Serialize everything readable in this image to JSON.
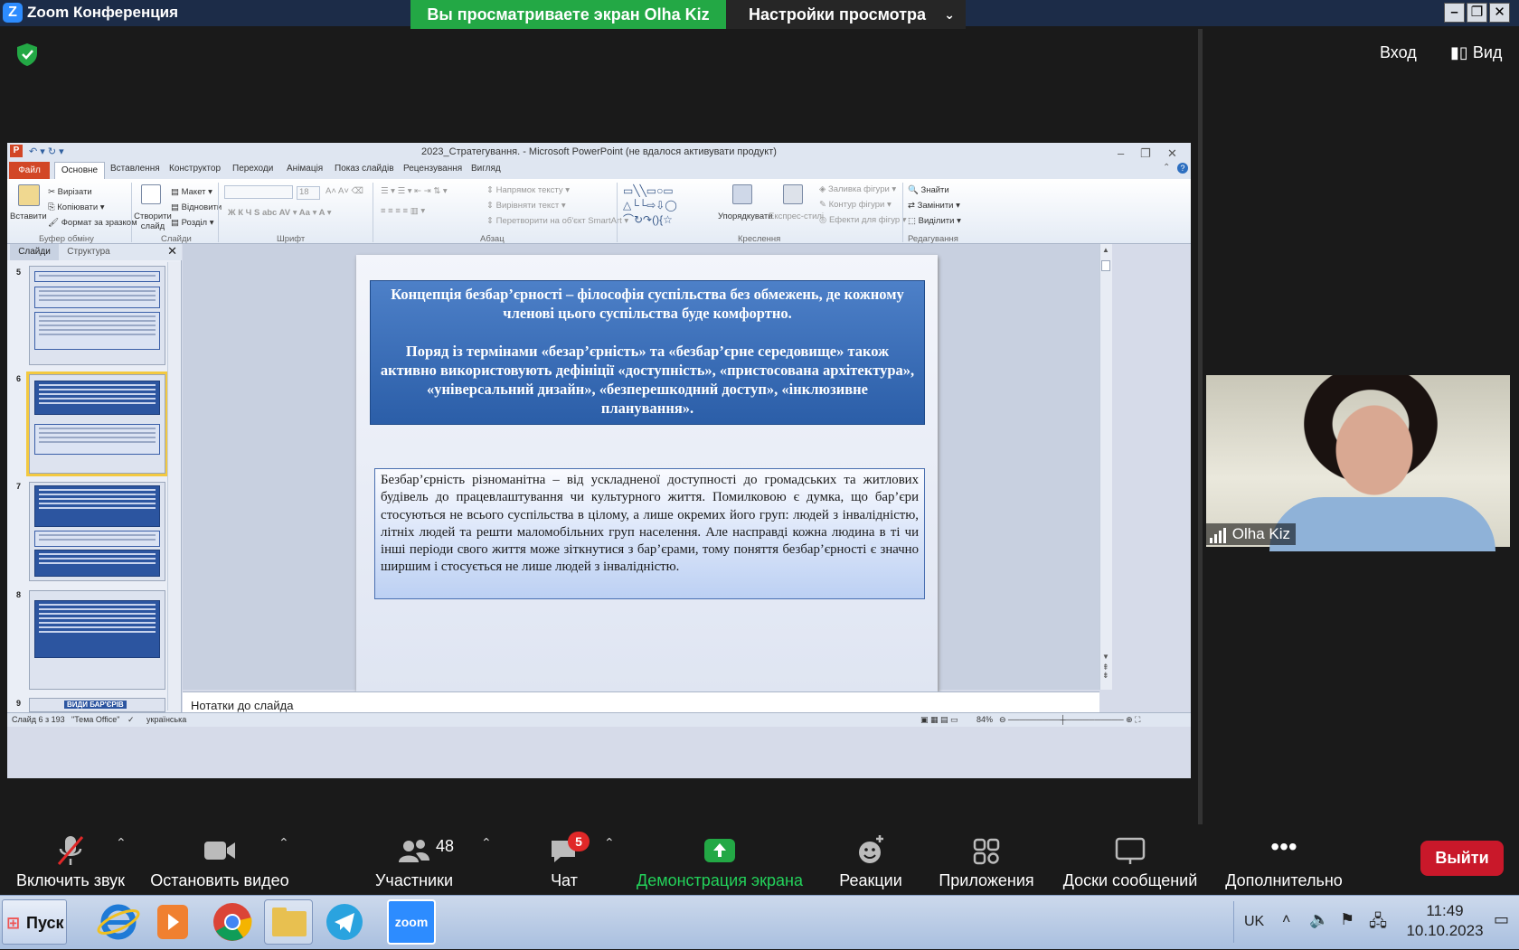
{
  "zoom": {
    "window_title": "Zoom Конференция",
    "viewing_banner": "Вы просматриваете экран Olha Kiz",
    "view_settings": "Настройки просмотра",
    "enter_label": "Вход",
    "view_label": "Вид",
    "participant_name": "Olha Kiz",
    "toolbar": {
      "mute": "Включить звук",
      "video": "Остановить видео",
      "participants": "Участники",
      "participants_count": "48",
      "chat": "Чат",
      "chat_badge": "5",
      "share": "Демонстрация экрана",
      "reactions": "Реакции",
      "apps": "Приложения",
      "whiteboards": "Доски сообщений",
      "more": "Дополнительно",
      "leave": "Выйти"
    }
  },
  "ppt": {
    "title": "2023_Стратегування. - Microsoft PowerPoint (не вдалося активувати продукт)",
    "tabs": [
      "Файл",
      "Основне",
      "Вставлення",
      "Конструктор",
      "Переходи",
      "Анімація",
      "Показ слайдів",
      "Рецензування",
      "Вигляд"
    ],
    "ribbon": {
      "paste": "Вставити",
      "cut": "Вирізати",
      "copy": "Копіювати",
      "format_painter": "Формат за зразком",
      "clipboard": "Буфер обміну",
      "new_slide": "Створити слайд",
      "layout": "Макет",
      "reset": "Відновити",
      "section": "Розділ",
      "slides": "Слайди",
      "font_size": "18",
      "font": "Шрифт",
      "text_direction": "Напрямок тексту",
      "align_text": "Вирівняти текст",
      "smartart": "Перетворити на об'єкт SmartArt",
      "paragraph": "Абзац",
      "arrange": "Упорядкувати",
      "quick_styles": "Експрес-стилі",
      "shape_fill": "Заливка фігури",
      "shape_outline": "Контур фігури",
      "shape_effects": "Ефекти для фігур",
      "drawing": "Креслення",
      "find": "Знайти",
      "replace": "Замінити",
      "select": "Виділити",
      "editing": "Редагування"
    },
    "panel_tabs": [
      "Слайди",
      "Структура"
    ],
    "thumb_numbers": [
      "5",
      "6",
      "7",
      "8",
      "9"
    ],
    "thumb9_title": "ВИДИ БАР'ЄРІВ",
    "slide": {
      "top_p1": "Концепція безбар’єрності – філософія суспільства без обмежень, де кожному членові цього суспільства буде комфортно.",
      "top_p2": "Поряд із термінами «безар’єрність» та «безбар’єрне середовище» також активно використовують дефініції «доступність», «пристосована архітектура», «універсальний дизайн», «безперешкодний доступ», «інклюзивне планування».",
      "bottom": "Безбар’єрність різноманітна – від ускладненої доступності до громадських та житлових будівель до працевлаштування чи культурного життя. Помилковою є думка, що бар’єри стосуються не всього суспільства в цілому, а лише окремих його груп: людей з інвалідністю, літніх людей та решти маломобільних груп населення. Але насправді кожна людина в ті чи інші періоди свого життя може зіткнутися з бар’єрами, тому поняття безбар’єрності є значно ширшим і стосується не лише людей з інвалідністю."
    },
    "notes_placeholder": "Нотатки до слайда",
    "status": {
      "slide": "Слайд 6 з 193",
      "theme": "\"Тема Office\"",
      "language": "українська",
      "zoom": "84%"
    }
  },
  "taskbar": {
    "start": "Пуск",
    "lang": "UK",
    "time": "11:49",
    "date": "10.10.2023",
    "zoom_app_label": "zoom"
  }
}
